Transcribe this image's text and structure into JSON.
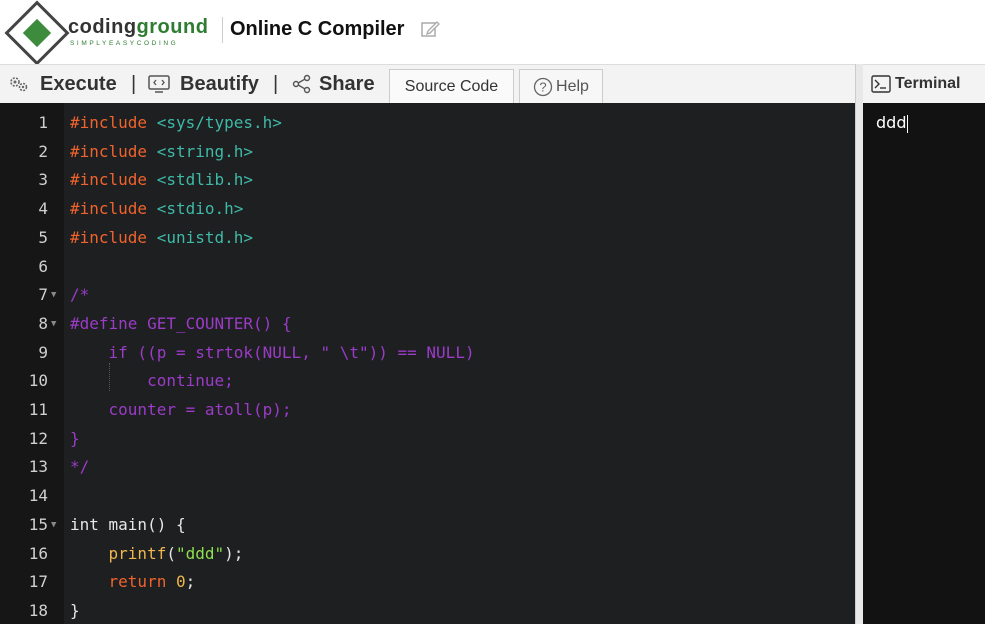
{
  "header": {
    "logo_text_coding": "coding",
    "logo_text_ground": "ground",
    "logo_tagline": "SIMPLYEASYCODING",
    "page_title": "Online C Compiler"
  },
  "toolbar": {
    "execute_label": "Execute",
    "beautify_label": "Beautify",
    "share_label": "Share",
    "separator": "|",
    "tabs": [
      {
        "label": "Source Code",
        "active": true
      },
      {
        "label": "Help",
        "active": false
      }
    ]
  },
  "terminal": {
    "title": "Terminal",
    "output": "ddd"
  },
  "editor": {
    "lines": [
      {
        "n": "1",
        "tokens": [
          [
            "inc",
            "#include "
          ],
          [
            "hdr",
            "<sys/types.h>"
          ]
        ]
      },
      {
        "n": "2",
        "tokens": [
          [
            "inc",
            "#include "
          ],
          [
            "hdr",
            "<string.h>"
          ]
        ]
      },
      {
        "n": "3",
        "tokens": [
          [
            "inc",
            "#include "
          ],
          [
            "hdr",
            "<stdlib.h>"
          ]
        ]
      },
      {
        "n": "4",
        "tokens": [
          [
            "inc",
            "#include "
          ],
          [
            "hdr",
            "<stdio.h>"
          ]
        ]
      },
      {
        "n": "5",
        "tokens": [
          [
            "inc",
            "#include "
          ],
          [
            "hdr",
            "<unistd.h>"
          ]
        ]
      },
      {
        "n": "6",
        "tokens": []
      },
      {
        "n": "7",
        "fold": true,
        "tokens": [
          [
            "cmt",
            "/*"
          ]
        ]
      },
      {
        "n": "8",
        "fold": true,
        "tokens": [
          [
            "cmt",
            "#define GET_COUNTER() {"
          ]
        ]
      },
      {
        "n": "9",
        "tokens": [
          [
            "cmt",
            "    if ((p = strtok(NULL, \" \\t\")) == NULL)"
          ]
        ]
      },
      {
        "n": "10",
        "tokens": [
          [
            "cmt",
            "        continue;"
          ]
        ]
      },
      {
        "n": "11",
        "tokens": [
          [
            "cmt",
            "    counter = atoll(p);"
          ]
        ]
      },
      {
        "n": "12",
        "tokens": [
          [
            "cmt",
            "}"
          ]
        ]
      },
      {
        "n": "13",
        "tokens": [
          [
            "cmt",
            "*/"
          ]
        ]
      },
      {
        "n": "14",
        "tokens": []
      },
      {
        "n": "15",
        "fold": true,
        "tokens": [
          [
            "plain",
            "int main() {"
          ]
        ]
      },
      {
        "n": "16",
        "tokens": [
          [
            "plain",
            "    "
          ],
          [
            "fn",
            "printf"
          ],
          [
            "plain",
            "("
          ],
          [
            "str",
            "\"ddd\""
          ],
          [
            "plain",
            ");"
          ]
        ]
      },
      {
        "n": "17",
        "tokens": [
          [
            "plain",
            "    "
          ],
          [
            "kw",
            "return"
          ],
          [
            "plain",
            " "
          ],
          [
            "num",
            "0"
          ],
          [
            "plain",
            ";"
          ]
        ]
      },
      {
        "n": "18",
        "tokens": [
          [
            "plain",
            "}"
          ]
        ]
      }
    ]
  }
}
